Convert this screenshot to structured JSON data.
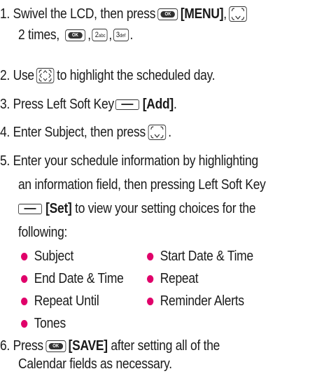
{
  "steps": [
    {
      "num": "1.",
      "line1_text": "Swivel the LCD, then press",
      "menu": "[MENU]",
      "line2_text": "2 times,",
      "comma": ","
    },
    {
      "num": "2.",
      "before": "Use",
      "after": "to highlight the scheduled day."
    },
    {
      "num": "3.",
      "text": "Press Left Soft Key",
      "add": "[Add]",
      "period": "."
    },
    {
      "num": "4.",
      "text": "Enter Subject, then press",
      "period": "."
    },
    {
      "num": "5.",
      "line1": "Enter your schedule information by highlighting",
      "line2": "an information field, then pressing Left Soft Key",
      "set": "[Set]",
      "line3_text": "to view your setting choices for the",
      "line4": "following:"
    },
    {
      "num": "6.",
      "press": "Press",
      "save": "[SAVE]",
      "line1_rest": "after setting all of the",
      "line2": "Calendar fields as necessary."
    }
  ],
  "keys": {
    "ok": "OK",
    "two": "2",
    "two_sub": "abc",
    "three": "3",
    "three_sub": "def"
  },
  "options": [
    "Subject",
    "Start Date & Time",
    "End Date & Time",
    "Repeat",
    "Repeat Until",
    "Reminder Alerts",
    "Tones"
  ],
  "colors": {
    "bullet": "#e0006a",
    "text": "#1a1a1a"
  }
}
